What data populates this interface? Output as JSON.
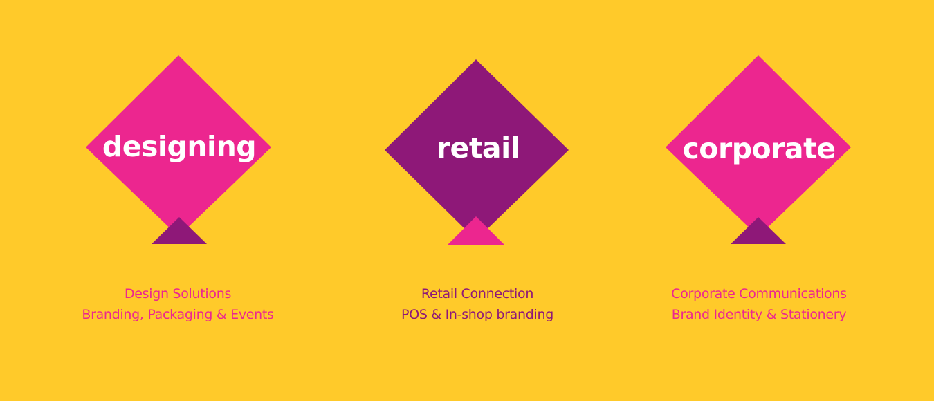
{
  "colors": {
    "background": "#FFCA2A",
    "magenta": "#EC268F",
    "purple": "#8E1878",
    "white": "#FFFFFF"
  },
  "services": [
    {
      "title": "designing",
      "diamond_color": "magenta",
      "tail_color": "purple",
      "caption_color": "magenta",
      "line1": "Design Solutions",
      "line2": "Branding, Packaging & Events"
    },
    {
      "title": "retail",
      "diamond_color": "purple",
      "tail_color": "magenta",
      "caption_color": "purple",
      "line1": "Retail Connection",
      "line2": "POS & In-shop branding"
    },
    {
      "title": "corporate",
      "diamond_color": "magenta",
      "tail_color": "purple",
      "caption_color": "magenta",
      "line1": "Corporate Communications",
      "line2": "Brand Identity & Stationery"
    }
  ]
}
